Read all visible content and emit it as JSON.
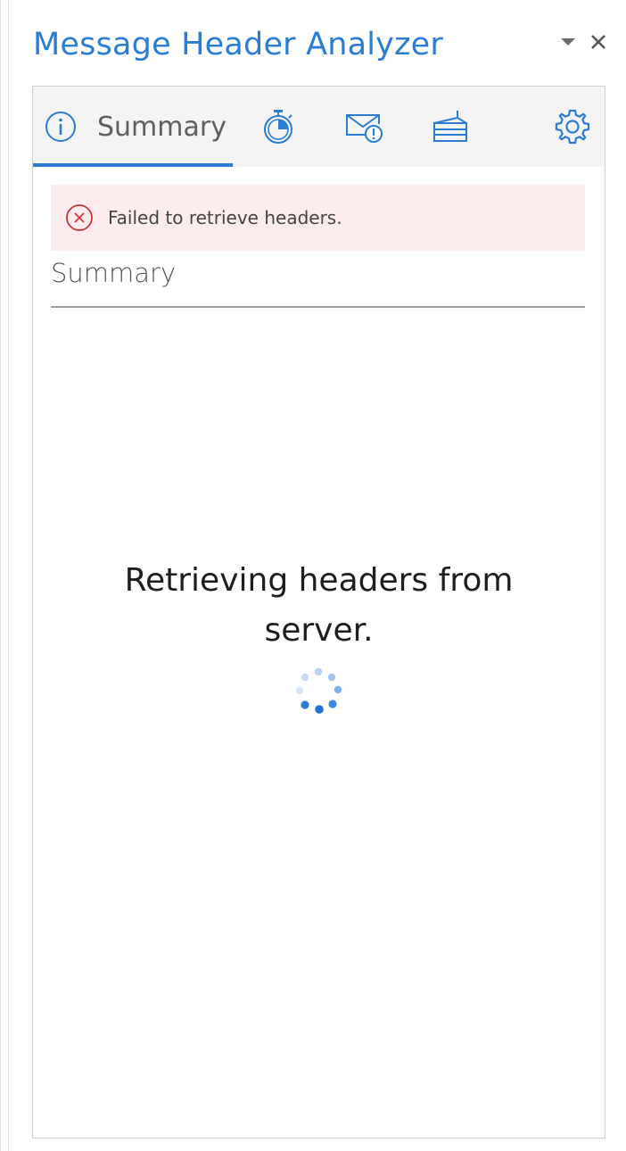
{
  "window": {
    "title": "Message Header Analyzer",
    "menu_icon": "caret-down-icon",
    "close_icon": "close-icon"
  },
  "tabs": [
    {
      "id": "summary",
      "label": "Summary",
      "icon": "info-icon",
      "selected": true
    },
    {
      "id": "timeline",
      "label": "",
      "icon": "stopwatch-icon",
      "selected": false
    },
    {
      "id": "antispam",
      "label": "",
      "icon": "mail-alert-icon",
      "selected": false
    },
    {
      "id": "other",
      "label": "",
      "icon": "stack-icon",
      "selected": false
    }
  ],
  "settings_icon": "gear-icon",
  "error": {
    "text": "Failed to retrieve headers.",
    "icon": "error-circle-icon"
  },
  "summary": {
    "heading": "Summary"
  },
  "loading": {
    "line1": "Retrieving headers from",
    "line2": "server."
  },
  "colors": {
    "accent": "#2b7cd3",
    "error_bg": "#fdeced",
    "error_icon": "#d13438",
    "tab_bg": "#f4f4f4"
  }
}
